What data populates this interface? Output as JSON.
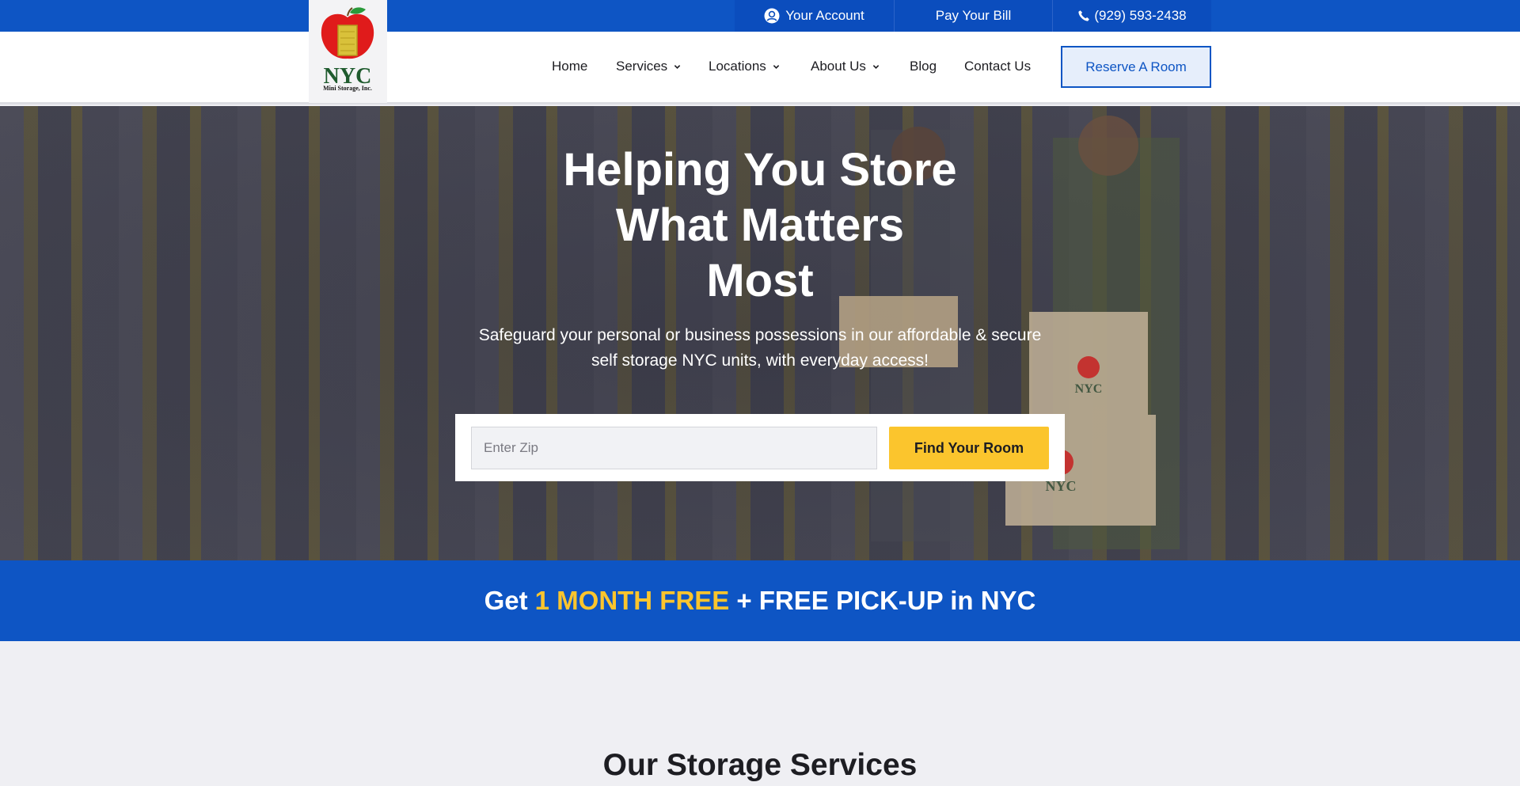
{
  "topbar": {
    "account_label": "Your Account",
    "bill_label": "Pay Your Bill",
    "phone_label": "(929) 593-2438",
    "icons": {
      "account": "user-circle-icon",
      "phone": "phone-icon"
    }
  },
  "logo": {
    "title": "NYC",
    "subtitle": "Mini Storage, Inc."
  },
  "nav": {
    "items": [
      {
        "label": "Home",
        "dropdown": false
      },
      {
        "label": "Services",
        "dropdown": true
      },
      {
        "label": "Locations",
        "dropdown": true
      },
      {
        "label": "About Us",
        "dropdown": true
      },
      {
        "label": "Blog",
        "dropdown": false
      },
      {
        "label": "Contact Us",
        "dropdown": false
      }
    ],
    "cta_label": "Reserve A Room"
  },
  "hero": {
    "title_lines": [
      "Helping You Store",
      "What Matters",
      "Most"
    ],
    "subtitle": "Safeguard your personal or business possessions in our affordable & secure self storage NYC units, with everyday access!",
    "zip_placeholder": "Enter Zip",
    "zip_value": "",
    "find_button": "Find Your Room",
    "box_logo": "NYC"
  },
  "promo": {
    "prefix": "Get",
    "highlight": "1 MONTH FREE",
    "suffix": "+ FREE PICK-UP in NYC"
  },
  "services": {
    "title": "Our Storage Services"
  },
  "colors": {
    "brand_blue": "#0e55c4",
    "accent_yellow": "#fbc52d",
    "text_dark": "#1d1d22"
  }
}
